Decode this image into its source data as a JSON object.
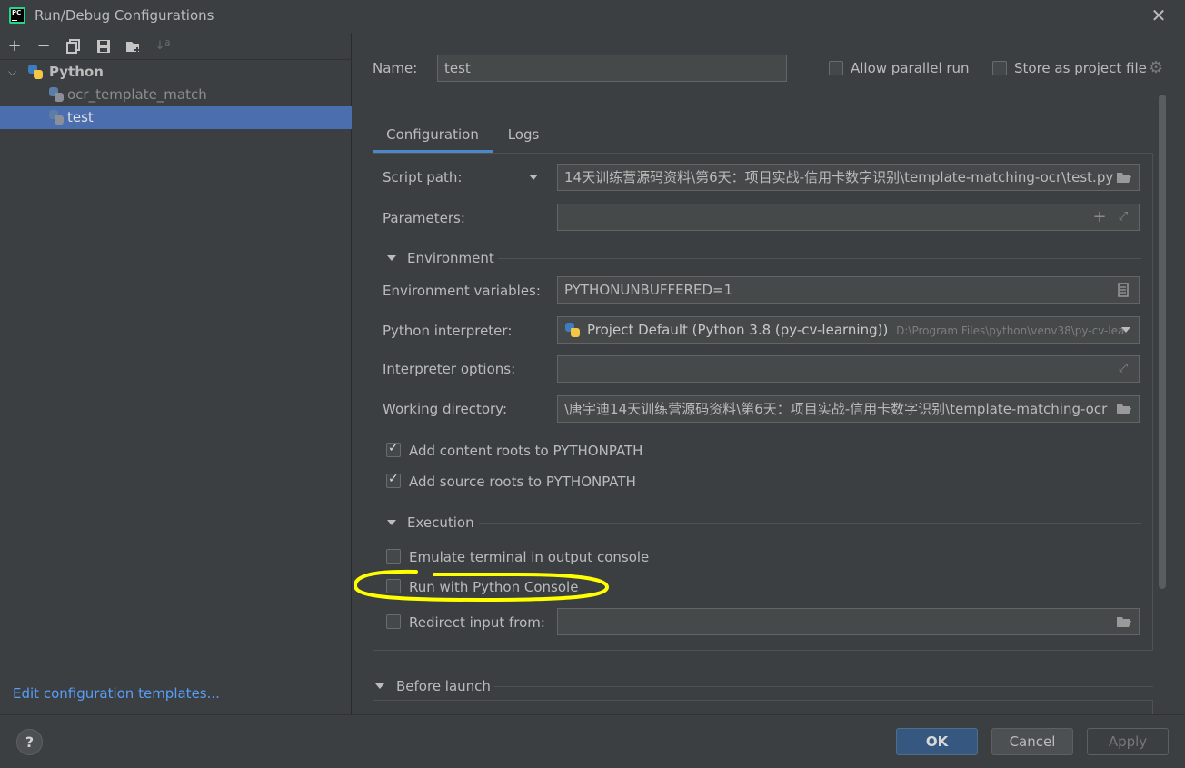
{
  "window": {
    "title": "Run/Debug Configurations"
  },
  "toolbar": {
    "add": "+",
    "remove": "−",
    "copy": "⧉",
    "save": "🖫",
    "folder": "📁",
    "sort": "↓ª"
  },
  "tree": {
    "group_label": "Python",
    "items": [
      {
        "label": "ocr_template_match"
      },
      {
        "label": "test"
      }
    ]
  },
  "sidebar": {
    "edit_templates": "Edit configuration templates..."
  },
  "form": {
    "name_label": "Name:",
    "name_value": "test",
    "allow_parallel_run": "Allow parallel run",
    "store_as_project_file": "Store as project file",
    "tabs": [
      {
        "label": "Configuration"
      },
      {
        "label": "Logs"
      }
    ],
    "script_path_label": "Script path:",
    "script_path_value": "14天训练营源码资料\\第6天：项目实战-信用卡数字识别\\template-matching-ocr\\test.py",
    "parameters_label": "Parameters:",
    "parameters_value": "",
    "environment_section": "Environment",
    "env_vars_label": "Environment variables:",
    "env_vars_value": "PYTHONUNBUFFERED=1",
    "interpreter_label": "Python interpreter:",
    "interpreter_value": "Project Default (Python 3.8 (py-cv-learning))",
    "interpreter_path": "D:\\Program Files\\python\\venv38\\py-cv-lea",
    "interpreter_options_label": "Interpreter options:",
    "interpreter_options_value": "",
    "working_dir_label": "Working directory:",
    "working_dir_value": "\\唐宇迪14天训练营源码资料\\第6天：项目实战-信用卡数字识别\\template-matching-ocr",
    "add_content_roots": "Add content roots to PYTHONPATH",
    "add_source_roots": "Add source roots to PYTHONPATH",
    "execution_section": "Execution",
    "emulate_terminal": "Emulate terminal in output console",
    "run_with_console": "Run with Python Console",
    "redirect_input": "Redirect input from:",
    "redirect_input_value": "",
    "before_launch_section": "Before launch"
  },
  "buttons": {
    "help": "?",
    "ok": "OK",
    "cancel": "Cancel",
    "apply": "Apply"
  },
  "colors": {
    "background": "#3c3f41",
    "selection": "#4b6eaf",
    "accent": "#4a88c7",
    "link": "#589df6",
    "highlight_annotation": "#ffff00"
  }
}
